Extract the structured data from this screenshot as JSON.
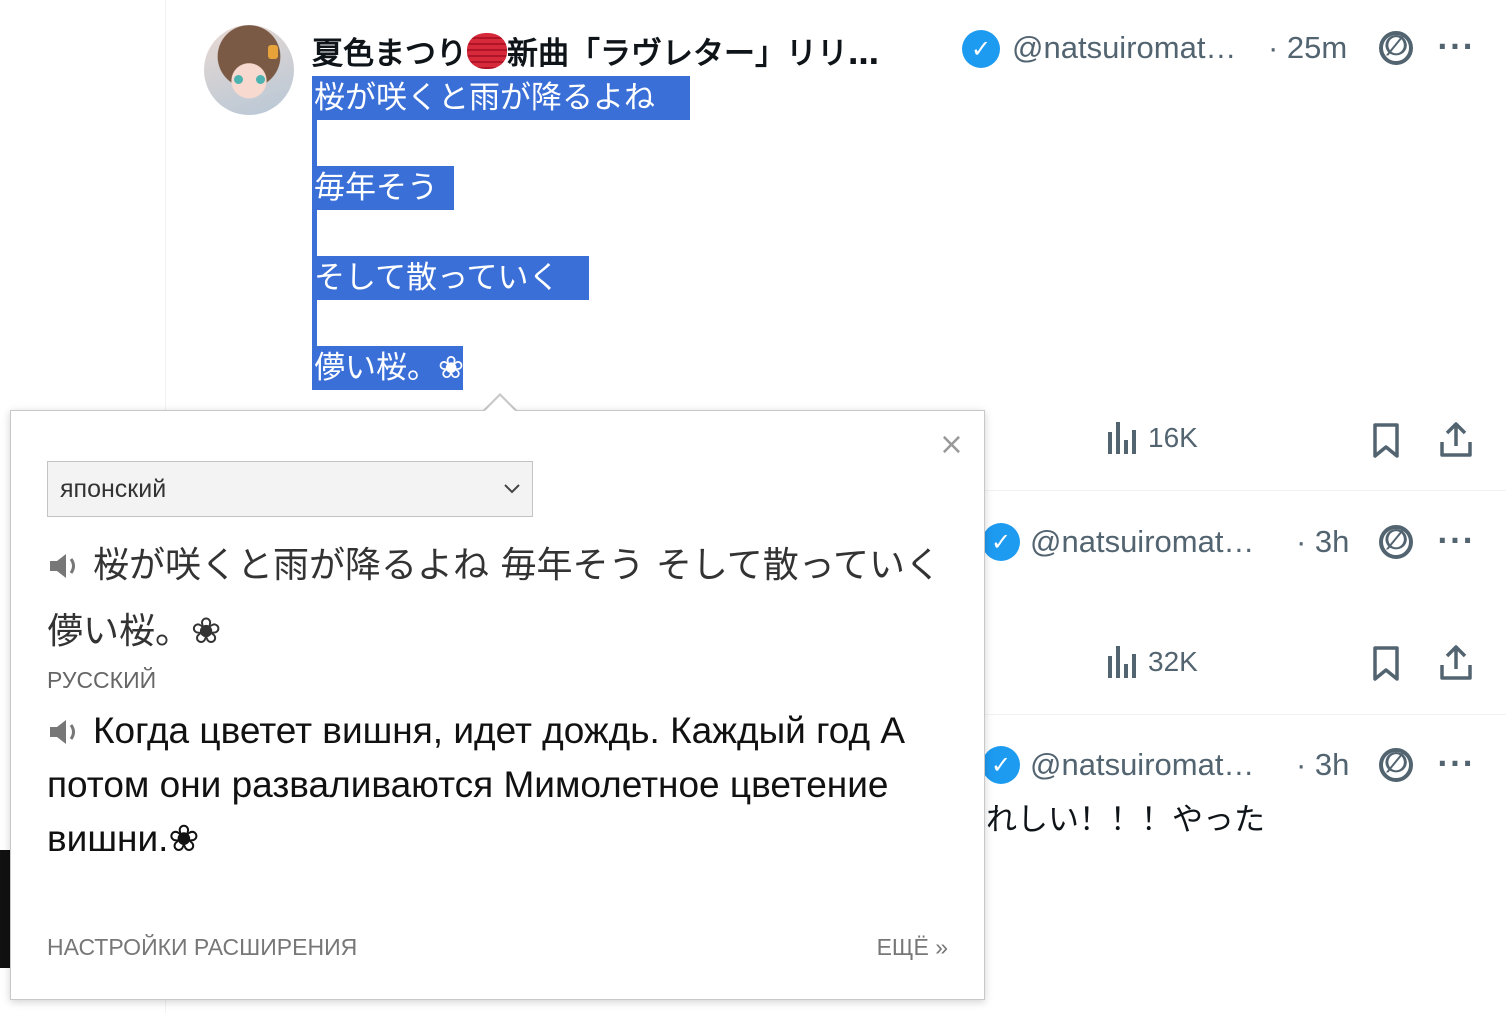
{
  "tweet1": {
    "display_name": "夏色まつり",
    "display_name_suffix": "新曲「ラヴレター」リリ…",
    "lantern_icon": "lantern-emoji",
    "handle": "@natsuiromat…",
    "time": "· 25m",
    "text_lines": [
      "桜が咲くと雨が降るよね",
      "毎年そう",
      "そして散っていく",
      "儚い桜。❀"
    ],
    "views": "16K"
  },
  "tweet2": {
    "handle": "@natsuiromat…",
    "time": "· 3h",
    "views": "32K"
  },
  "tweet3": {
    "handle": "@natsuiromat…",
    "time": "· 3h",
    "text_fragment": "れしい！！！やった"
  },
  "popup": {
    "close": "×",
    "source_language": "японский",
    "source_text": "桜が咲くと雨が降るよね 毎年そう そして散っていく 儚い桜。❀",
    "target_language": "РУССКИЙ",
    "translated_text": "Когда цветет вишня, идет дождь. Каждый год А потом они разваливаются Мимолетное цветение вишни.❀",
    "settings_link": "НАСТРОЙКИ РАСШИРЕНИЯ",
    "more_link": "ЕЩЁ »"
  },
  "icons": {
    "verified": "✓",
    "grok": "∅",
    "more": "···"
  },
  "colors": {
    "selection": "#3a6fd8",
    "verified": "#1d9bf0",
    "muted": "#536471"
  }
}
